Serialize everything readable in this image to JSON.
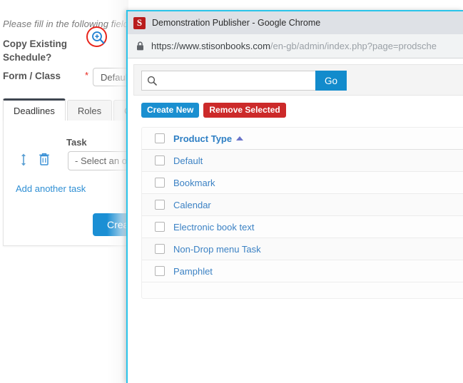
{
  "background_page": {
    "instructions": "Please fill in the following fields. C",
    "zoom_icon_name": "magnifier-zoom-in-icon",
    "copy_existing_label": "Copy Existing Schedule?",
    "form_class_label": "Form / Class",
    "required_marker": "*",
    "form_class_value": "Default",
    "tabs": [
      {
        "label": "Deadlines",
        "active": true
      },
      {
        "label": "Roles",
        "active": false
      },
      {
        "label": "Cos",
        "active": false
      }
    ],
    "task_column_header": "Task",
    "task_select_value": "- Select an op",
    "add_task_link": "Add another task",
    "create_button": "Creat",
    "annotation_color": "#e8251c",
    "accent_blue": "#1b8fd4"
  },
  "popup": {
    "window_title": "Demonstration Publisher - Google Chrome",
    "logo_letter": "S",
    "lock_icon_name": "padlock-secure-icon",
    "url_host": "https://www.stisonbooks.com",
    "url_path": "/en-gb/admin/index.php?page=prodsche",
    "border_color": "#2ac4ea",
    "search": {
      "value": "",
      "placeholder": "",
      "icon_name": "search-icon",
      "go_label": "Go"
    },
    "actions": {
      "create_new": "Create New",
      "remove_selected": "Remove Selected",
      "create_new_color": "#1a8fd0",
      "remove_selected_color": "#cc2a2a"
    },
    "table": {
      "column_header": "Product Type",
      "sort_direction": "ascending",
      "rows": [
        {
          "label": "Default"
        },
        {
          "label": "Bookmark"
        },
        {
          "label": "Calendar"
        },
        {
          "label": "Electronic book text"
        },
        {
          "label": "Non-Drop menu Task"
        },
        {
          "label": "Pamphlet"
        }
      ]
    }
  }
}
